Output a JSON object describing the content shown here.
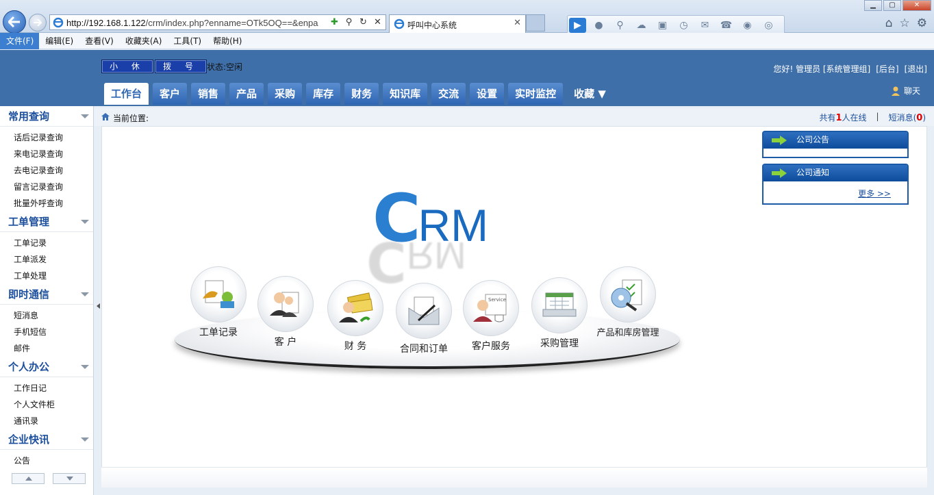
{
  "browser": {
    "url_domain": "http://192.168.1.122",
    "url_rest": "/crm/index.php?enname=OTk5OQ==&enpa",
    "tab_title": "呼叫中心系统"
  },
  "menubar": [
    "文件(F)",
    "编辑(E)",
    "查看(V)",
    "收藏夹(A)",
    "工具(T)",
    "帮助(H)"
  ],
  "header": {
    "hold_label": "小 休",
    "dial_label": "拨 号",
    "status": "状态:空闲",
    "greeting": "您好! 管理员 [系统管理组]",
    "backend": "[后台]",
    "logout": "[退出]",
    "chat": "聊天"
  },
  "maintabs": [
    "工作台",
    "客户",
    "销售",
    "产品",
    "采购",
    "库存",
    "财务",
    "知识库",
    "交流",
    "设置",
    "实时监控",
    "收藏"
  ],
  "sidebar": [
    {
      "title": "常用查询",
      "items": [
        "话后记录查询",
        "来电记录查询",
        "去电记录查询",
        "留言记录查询",
        "批量外呼查询"
      ]
    },
    {
      "title": "工单管理",
      "items": [
        "工单记录",
        "工单派发",
        "工单处理"
      ]
    },
    {
      "title": "即时通信",
      "items": [
        "短消息",
        "手机短信",
        "邮件"
      ]
    },
    {
      "title": "个人办公",
      "items": [
        "工作日记",
        "个人文件柜",
        "通讯录"
      ]
    },
    {
      "title": "企业快讯",
      "items": [
        "公告"
      ]
    }
  ],
  "breadcrumb": {
    "label": "当前位置:",
    "online_prefix": "共有",
    "online_count": "1",
    "online_suffix": "人在线",
    "sms_prefix": "短消息(",
    "sms_count": "0",
    "sms_suffix": ")"
  },
  "logo": {
    "c": "C",
    "rm": "RM"
  },
  "modules": [
    "工单记录",
    "客 户",
    "财 务",
    "合同和订单",
    "客户服务",
    "采购管理",
    "产品和库房管理"
  ],
  "panels": {
    "announcement": "公司公告",
    "notice": "公司通知",
    "more": "更多 >>"
  },
  "colors": {
    "header_bg": "#3f6fa9",
    "accent": "#1b4e9c",
    "tab_active_text": "#2f66b3"
  }
}
